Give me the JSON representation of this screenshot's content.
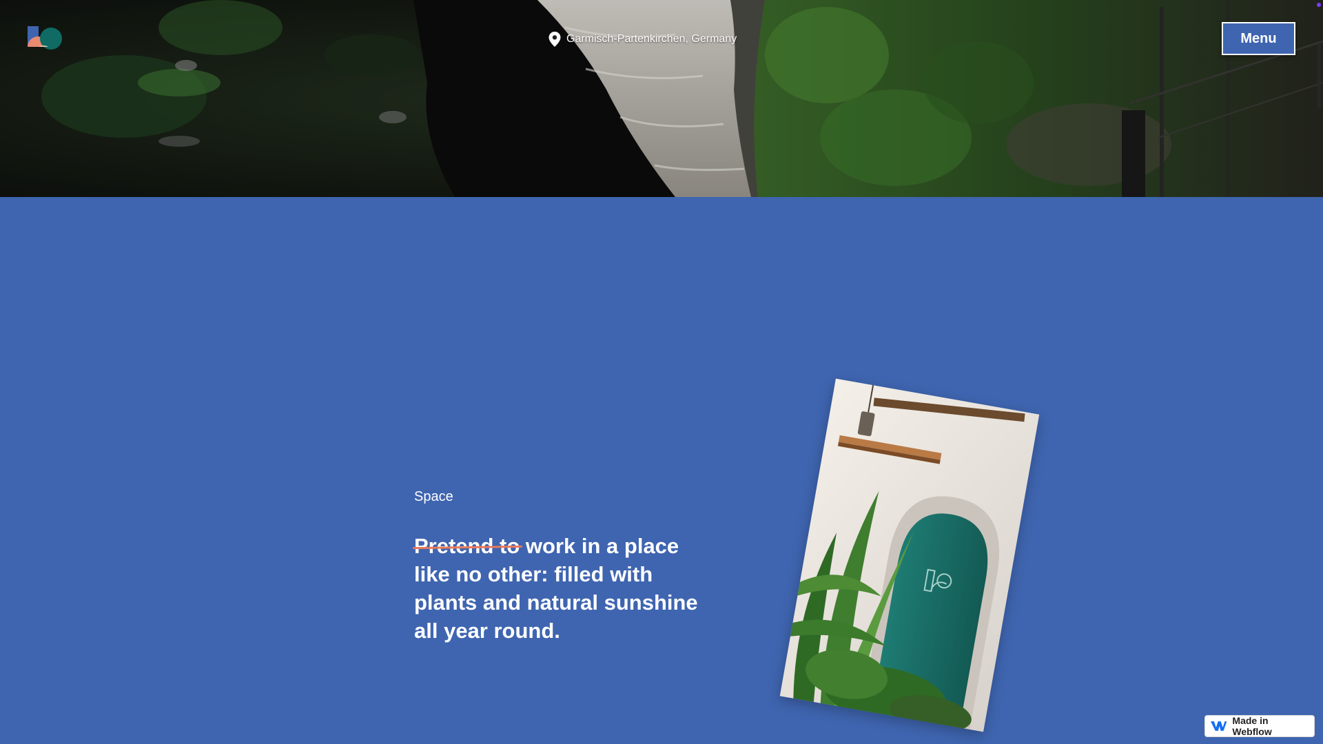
{
  "header": {
    "location": "Garmisch-Partenkirchen, Germany",
    "menu_label": "Menu"
  },
  "content": {
    "section_label": "Space",
    "headline_struck": "Pretend to",
    "headline_rest": " work in a place like no other: filled with plants and natural sunshine all year round."
  },
  "badge": {
    "label": "Made in Webflow"
  },
  "colors": {
    "background_blue": "#3f65b0",
    "strike_accent": "#e7795a",
    "text": "#ffffff"
  },
  "icons": {
    "logo": "logo-icon",
    "location": "location-pin-icon",
    "webflow": "webflow-logo-icon"
  }
}
